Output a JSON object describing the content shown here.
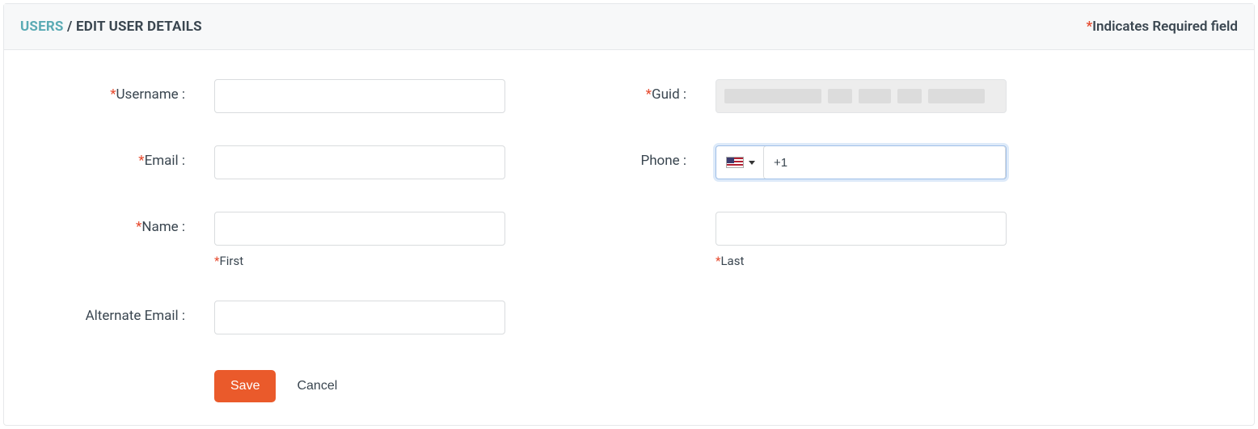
{
  "header": {
    "breadcrumb_root": "USERS",
    "breadcrumb_sep": " / ",
    "breadcrumb_current": "EDIT USER DETAILS",
    "required_note_prefix": "*",
    "required_note": "Indicates Required field"
  },
  "form": {
    "username": {
      "label": "Username :",
      "required": true,
      "value": ""
    },
    "guid": {
      "label": "Guid :",
      "required": true,
      "value": ""
    },
    "email": {
      "label": "Email :",
      "required": true,
      "value": ""
    },
    "phone": {
      "label": "Phone :",
      "required": false,
      "dial_code": "+1",
      "country": "us"
    },
    "name": {
      "label": "Name :",
      "required": true,
      "first_value": "",
      "last_value": "",
      "first_sub": "First",
      "last_sub": "Last"
    },
    "alternate_email": {
      "label": "Alternate Email :",
      "required": false,
      "value": ""
    }
  },
  "actions": {
    "save": "Save",
    "cancel": "Cancel"
  }
}
